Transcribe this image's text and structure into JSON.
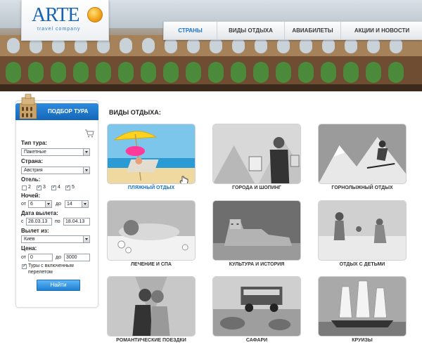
{
  "brand": {
    "name": "ARTE",
    "tagline": "travel company"
  },
  "nav": {
    "items": [
      {
        "label": "СТРАНЫ",
        "active": true
      },
      {
        "label": "ВИДЫ ОТДЫХА",
        "active": false
      },
      {
        "label": "АВИАБИЛЕТЫ",
        "active": false
      },
      {
        "label": "АКЦИИ И НОВОСТИ",
        "active": false
      }
    ]
  },
  "sidebar": {
    "title": "ПОДБОР ТУРА",
    "tour_type_label": "Тип тура:",
    "tour_type_value": "Пакетные",
    "country_label": "Страна:",
    "country_value": "Австрия",
    "hotel_label": "Отель:",
    "hotel_stars": [
      {
        "label": "2",
        "checked": false
      },
      {
        "label": "3",
        "checked": true
      },
      {
        "label": "4",
        "checked": true
      },
      {
        "label": "5",
        "checked": true
      }
    ],
    "nights_label": "Ночей:",
    "nights_from_prefix": "от",
    "nights_from": "6",
    "nights_to_prefix": "до",
    "nights_to": "14",
    "date_label": "Дата вылета:",
    "date_from_prefix": "с",
    "date_from": "28.03.13",
    "date_to_prefix": "по",
    "date_to": "18.04.13",
    "departure_label": "Вылет из:",
    "departure_value": "Киев",
    "price_label": "Цена:",
    "price_from_prefix": "от",
    "price_from": "0",
    "price_to_prefix": "до",
    "price_to": "3000",
    "flight_included_line1": "Туры с включенным",
    "flight_included_line2": "перелетом",
    "flight_included_checked": true,
    "search_button": "Найти"
  },
  "main": {
    "title": "ВИДЫ ОТДЫХА:",
    "tiles": [
      {
        "label": "ПЛЯЖНЫЙ ОТДЫХ",
        "active": true
      },
      {
        "label": "ГОРОДА И ШОПИНГ",
        "active": false
      },
      {
        "label": "ГОРНОЛЫЖНЫЙ ОТДЫХ",
        "active": false
      },
      {
        "label": "ЛЕЧЕНИЕ И СПА",
        "active": false
      },
      {
        "label": "КУЛЬТУРА И ИСТОРИЯ",
        "active": false
      },
      {
        "label": "ОТДЫХ С ДЕТЬМИ",
        "active": false
      },
      {
        "label": "РОМАНТИЧЕСКИЕ ПОЕЗДКИ",
        "active": false
      },
      {
        "label": "САФАРИ",
        "active": false
      },
      {
        "label": "КРУИЗЫ",
        "active": false
      }
    ]
  },
  "colors": {
    "accent": "#1b73c7",
    "header_blue": "#1f7fd2",
    "text": "#222222"
  },
  "icons": [
    "colosseum-icon",
    "cart-icon",
    "globe-icon",
    "pointer-hand-icon"
  ]
}
